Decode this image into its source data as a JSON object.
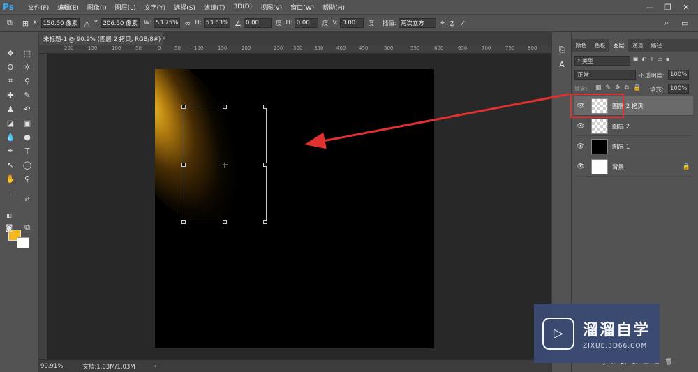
{
  "app": {
    "logo": "Ps"
  },
  "menu": [
    "文件(F)",
    "编辑(E)",
    "图像(I)",
    "图层(L)",
    "文字(Y)",
    "选择(S)",
    "滤镜(T)",
    "3D(D)",
    "视图(V)",
    "窗口(W)",
    "帮助(H)"
  ],
  "window_controls": {
    "minimize": "—",
    "restore": "❐",
    "close": "✕"
  },
  "options": {
    "x_label": "X:",
    "x_value": "150.50 像素",
    "y_label": "Y:",
    "y_value": "206.50 像素",
    "w_label": "W:",
    "w_value": "53.75%",
    "h_label": "H:",
    "h_value": "53.63%",
    "angle_value": "0.00",
    "angle_unit": "度",
    "hskew_label": "H:",
    "hskew_value": "0.00",
    "hskew_unit": "度",
    "vskew_label": "V:",
    "vskew_value": "0.00",
    "vskew_unit": "度",
    "interp_label": "插值:",
    "interp_value": "两次立方"
  },
  "document": {
    "tab_title": "未标题-1 @ 90.9% (图层 2 拷贝, RGB/8#) *"
  },
  "ruler_top": [
    "200",
    "150",
    "100",
    "50",
    "0",
    "50",
    "100",
    "150",
    "200",
    "250",
    "300",
    "350",
    "400",
    "450",
    "500",
    "550",
    "600",
    "650",
    "700",
    "750",
    "800"
  ],
  "status": {
    "zoom": "90.91%",
    "doc_info": "文档:1.03M/1.03M",
    "arrow": "›"
  },
  "layers_panel": {
    "tabs": [
      "颜色",
      "色板",
      "图层",
      "通道",
      "路径"
    ],
    "active_tab": "图层",
    "filter_kind": "类型",
    "blend_mode": "正常",
    "opacity_label": "不透明度:",
    "opacity_value": "100%",
    "lock_label": "锁定:",
    "fill_label": "填充:",
    "fill_value": "100%",
    "layers": [
      {
        "name": "图层 2 拷贝",
        "thumb": "checker",
        "selected": true
      },
      {
        "name": "图层 2",
        "thumb": "checker",
        "selected": false
      },
      {
        "name": "图层 1",
        "thumb": "black",
        "selected": false
      },
      {
        "name": "背景",
        "thumb": "white",
        "selected": false,
        "locked": true
      }
    ]
  },
  "colors": {
    "foreground": "#f6b820",
    "background": "#ffffff",
    "annotation": "#e03030"
  },
  "watermark": {
    "title": "溜溜自学",
    "url": "ZIXUE.3D66.COM"
  }
}
